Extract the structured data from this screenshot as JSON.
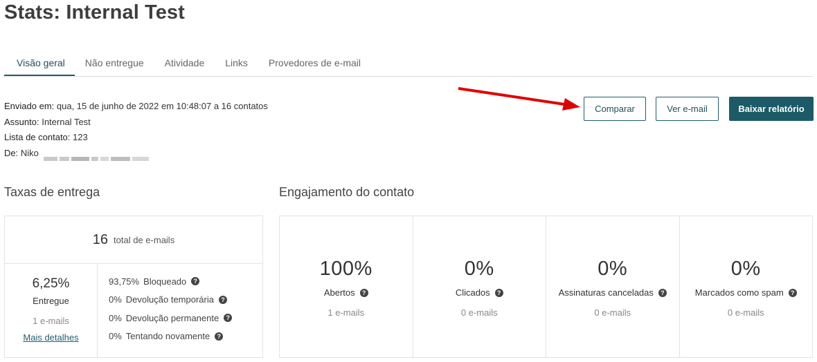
{
  "page_title": "Stats: Internal Test",
  "tabs": [
    {
      "label": "Visão geral",
      "active": true
    },
    {
      "label": "Não entregue",
      "active": false
    },
    {
      "label": "Atividade",
      "active": false
    },
    {
      "label": "Links",
      "active": false
    },
    {
      "label": "Provedores de e-mail",
      "active": false
    }
  ],
  "meta": {
    "sent_label": "Enviado em:",
    "sent_value": " qua, 15 de junho de 2022 em 10:48:07 a 16 contatos",
    "subject_label": "Assunto:",
    "subject_value": " Internal Test",
    "list_label": "Lista de contato:",
    "list_value": " 123",
    "from_label": "De:",
    "from_value": " Niko"
  },
  "buttons": {
    "compare": "Comparar",
    "view_email": "Ver e-mail",
    "download_report": "Baixar relatório"
  },
  "delivery": {
    "title": "Taxas de entrega",
    "total_count": "16",
    "total_label": "total de e-mails",
    "delivered_pct": "6,25%",
    "delivered_label": "Entregue",
    "delivered_sub": "1 e-mails",
    "details_link": "Mais detalhes",
    "rows": [
      {
        "pct": "93,75%",
        "label": "Bloqueado"
      },
      {
        "pct": "0%",
        "label": "Devolução temporária"
      },
      {
        "pct": "0%",
        "label": "Devolução permanente"
      },
      {
        "pct": "0%",
        "label": "Tentando novamente"
      }
    ]
  },
  "engagement": {
    "title": "Engajamento do contato",
    "cells": [
      {
        "value": "100%",
        "label": "Abertos",
        "sub": "1 e-mails"
      },
      {
        "value": "0%",
        "label": "Clicados",
        "sub": "0 e-mails"
      },
      {
        "value": "0%",
        "label": "Assinaturas canceladas",
        "sub": "0 e-mails"
      },
      {
        "value": "0%",
        "label": "Marcados como spam",
        "sub": "0 e-mails"
      }
    ]
  },
  "colors": {
    "accent": "#1c5a67",
    "annotation_arrow": "#e00000"
  },
  "icons": {
    "help": "question-circle-icon",
    "annotation": "red-arrow-icon"
  }
}
